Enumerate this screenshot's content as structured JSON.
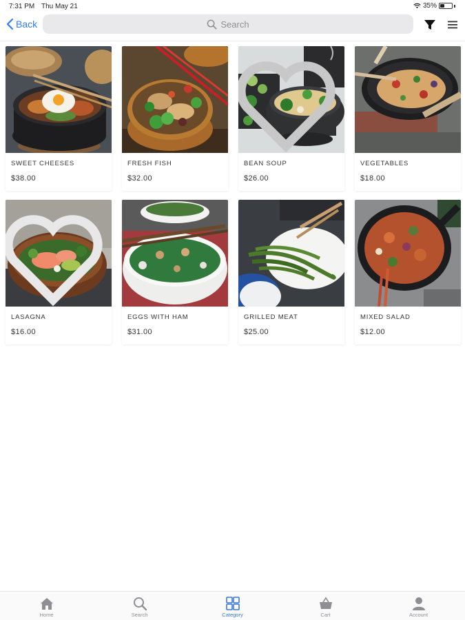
{
  "status_bar": {
    "time": "7:31 PM",
    "date": "Thu May 21",
    "battery_text": "35%",
    "battery_level": 0.35
  },
  "nav": {
    "back_label": "Back",
    "search_placeholder": "Search"
  },
  "products": [
    {
      "name": "SWEET CHEESES",
      "price": "$38.00",
      "image": "bibimbap-bowl"
    },
    {
      "name": "FRESH FISH",
      "price": "$32.00",
      "image": "noodle-salad-bowl"
    },
    {
      "name": "BEAN SOUP",
      "price": "$26.00",
      "image": "noodle-bowl-greens"
    },
    {
      "name": "VEGETABLES",
      "price": "$18.00",
      "image": "wok-noodles"
    },
    {
      "name": "LASAGNA",
      "price": "$16.00",
      "image": "salmon-avocado-bowl"
    },
    {
      "name": "EGGS WITH HAM",
      "price": "$31.00",
      "image": "green-soup-bowl"
    },
    {
      "name": "GRILLED MEAT",
      "price": "$25.00",
      "image": "green-beans-plate"
    },
    {
      "name": "MIXED SALAD",
      "price": "$12.00",
      "image": "skillet-stir-fry"
    }
  ],
  "tabs": [
    {
      "label": "Home",
      "icon": "home-icon",
      "active": false
    },
    {
      "label": "Search",
      "icon": "search-icon",
      "active": false
    },
    {
      "label": "Category",
      "icon": "grid-icon",
      "active": true
    },
    {
      "label": "Cart",
      "icon": "basket-icon",
      "active": false
    },
    {
      "label": "Account",
      "icon": "user-icon",
      "active": false
    }
  ],
  "colors": {
    "accent": "#2f7cf6",
    "tab_active": "#3a78d8",
    "tab_inactive": "#8e8e93",
    "search_bg": "#e9e9ec"
  }
}
